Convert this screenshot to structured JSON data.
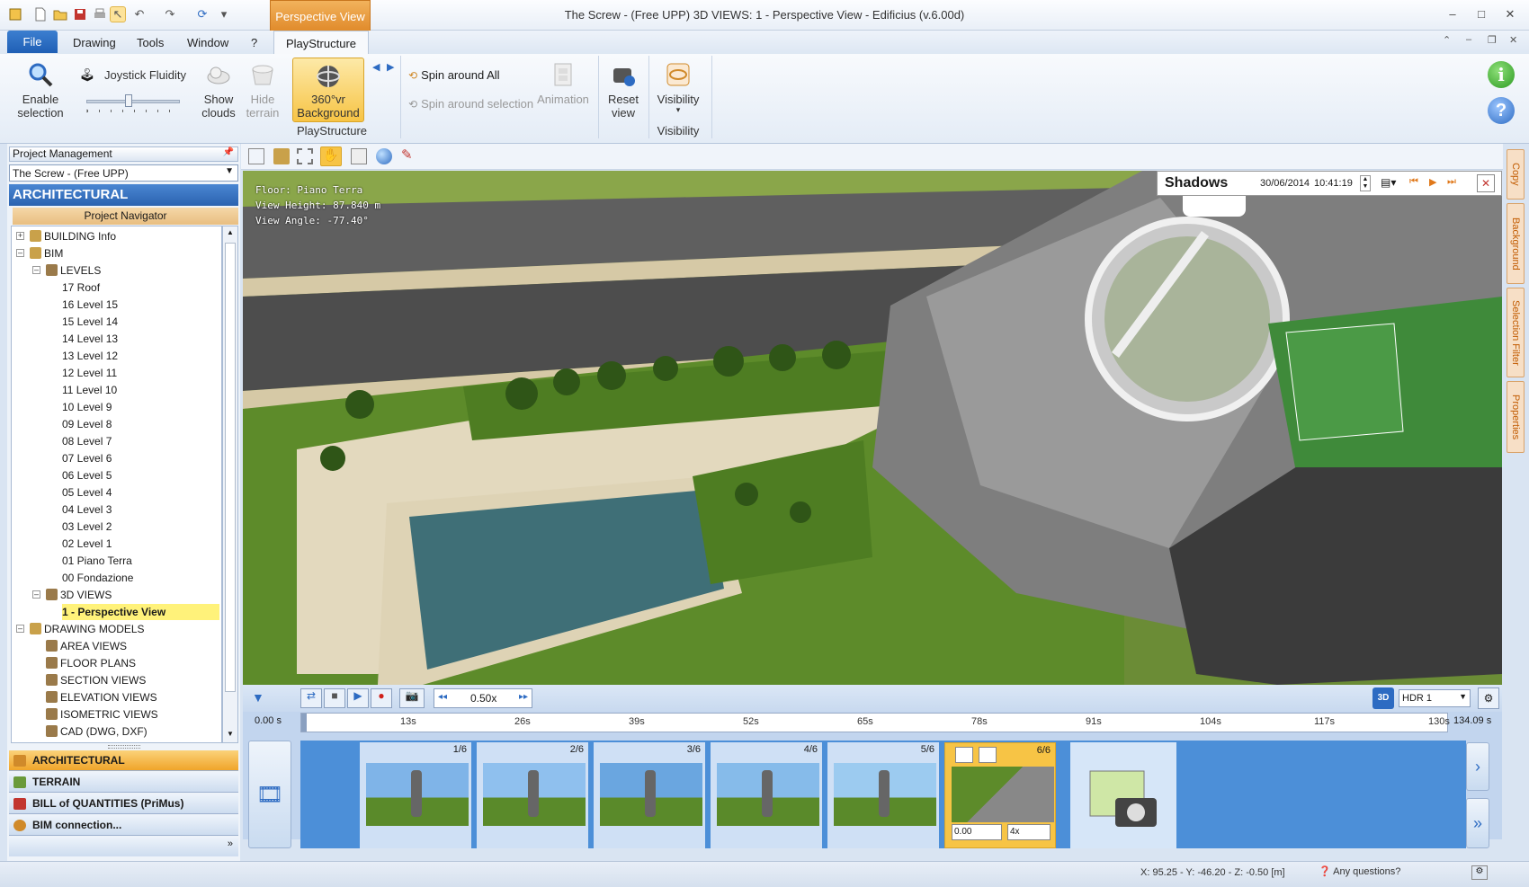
{
  "window": {
    "title": "The Screw - (Free UPP)  3D VIEWS: 1 - Perspective View - Edificius (v.6.00d)",
    "context_tab": "Perspective View",
    "controls": {
      "minimize": "–",
      "maximize": "□",
      "close": "✕"
    }
  },
  "menu": {
    "file": "File",
    "items": [
      "Drawing",
      "Tools",
      "Window",
      "?"
    ],
    "active_tab": "PlayStructure"
  },
  "ribbon": {
    "enable_selection": "Enable\nselection",
    "joystick_label": "Joystick Fluidity",
    "joystick_value": 0.45,
    "show_clouds": "Show\nclouds",
    "hide_terrain": "Hide\nterrain",
    "bg360": "360°vr\nBackground",
    "spin_all": "Spin around All",
    "spin_selection": "Spin around selection",
    "animation": "Animation",
    "reset_view": "Reset\nview",
    "visibility": "Visibility",
    "group_playstructure": "PlayStructure",
    "group_visibility": "Visibility"
  },
  "left": {
    "header": "Project Management",
    "project": "The Screw - (Free UPP)",
    "section": "ARCHITECTURAL",
    "navigator": "Project Navigator",
    "tree": [
      {
        "label": "BUILDING Info",
        "level": 0,
        "exp": "+"
      },
      {
        "label": "BIM",
        "level": 0,
        "exp": "–"
      },
      {
        "label": "LEVELS",
        "level": 1,
        "exp": "–"
      },
      {
        "label": "17 Roof",
        "level": 2
      },
      {
        "label": "16 Level 15",
        "level": 2
      },
      {
        "label": "15 Level 14",
        "level": 2
      },
      {
        "label": "14 Level 13",
        "level": 2
      },
      {
        "label": "13 Level 12",
        "level": 2
      },
      {
        "label": "12 Level 11",
        "level": 2
      },
      {
        "label": "11 Level 10",
        "level": 2
      },
      {
        "label": "10 Level 9",
        "level": 2
      },
      {
        "label": "09 Level 8",
        "level": 2
      },
      {
        "label": "08 Level 7",
        "level": 2
      },
      {
        "label": "07 Level 6",
        "level": 2
      },
      {
        "label": "06 Level 5",
        "level": 2
      },
      {
        "label": "05 Level 4",
        "level": 2
      },
      {
        "label": "04 Level 3",
        "level": 2
      },
      {
        "label": "03 Level 2",
        "level": 2
      },
      {
        "label": "02 Level 1",
        "level": 2
      },
      {
        "label": "01 Piano Terra",
        "level": 2
      },
      {
        "label": "00 Fondazione",
        "level": 2
      },
      {
        "label": "3D VIEWS",
        "level": 1,
        "exp": "–"
      },
      {
        "label": "1 - Perspective View",
        "level": 2,
        "selected": true
      },
      {
        "label": "DRAWING MODELS",
        "level": 0,
        "exp": "–"
      },
      {
        "label": "AREA VIEWS",
        "level": 1
      },
      {
        "label": "FLOOR PLANS",
        "level": 1
      },
      {
        "label": "SECTION VIEWS",
        "level": 1
      },
      {
        "label": "ELEVATION VIEWS",
        "level": 1
      },
      {
        "label": "ISOMETRIC VIEWS",
        "level": 1
      },
      {
        "label": "CAD (DWG, DXF)",
        "level": 1
      }
    ],
    "bottom_tabs": [
      "ARCHITECTURAL",
      "TERRAIN",
      "BILL of QUANTITIES (PriMus)",
      "BIM connection..."
    ]
  },
  "viewport": {
    "floor": "Floor: Piano Terra",
    "view_height": "View Height: 87.840 m",
    "view_angle": "View Angle: -77.40°"
  },
  "shadows": {
    "title": "Shadows",
    "date": "30/06/2014",
    "time": "10:41:19"
  },
  "right_tabs": [
    "Copy",
    "Background",
    "Selection Filter",
    "Properties"
  ],
  "anim": {
    "speed": "0.50x",
    "hdr": "HDR 1",
    "start": "0.00 s",
    "end": "134.09 s",
    "ticks": [
      "13s",
      "26s",
      "39s",
      "52s",
      "65s",
      "78s",
      "91s",
      "104s",
      "117s",
      "130s"
    ],
    "frames": [
      "1/6",
      "2/6",
      "3/6",
      "4/6",
      "5/6",
      "6/6"
    ],
    "frame_time": "0.00",
    "frame_mult": "4x"
  },
  "status": {
    "coords": "X: 95.25 - Y: -46.20 - Z: -0.50 [m]",
    "help": "Any questions?"
  },
  "colors": {
    "accent": "#2b63b0",
    "orange": "#e8a13a",
    "selected": "#fff27a"
  }
}
